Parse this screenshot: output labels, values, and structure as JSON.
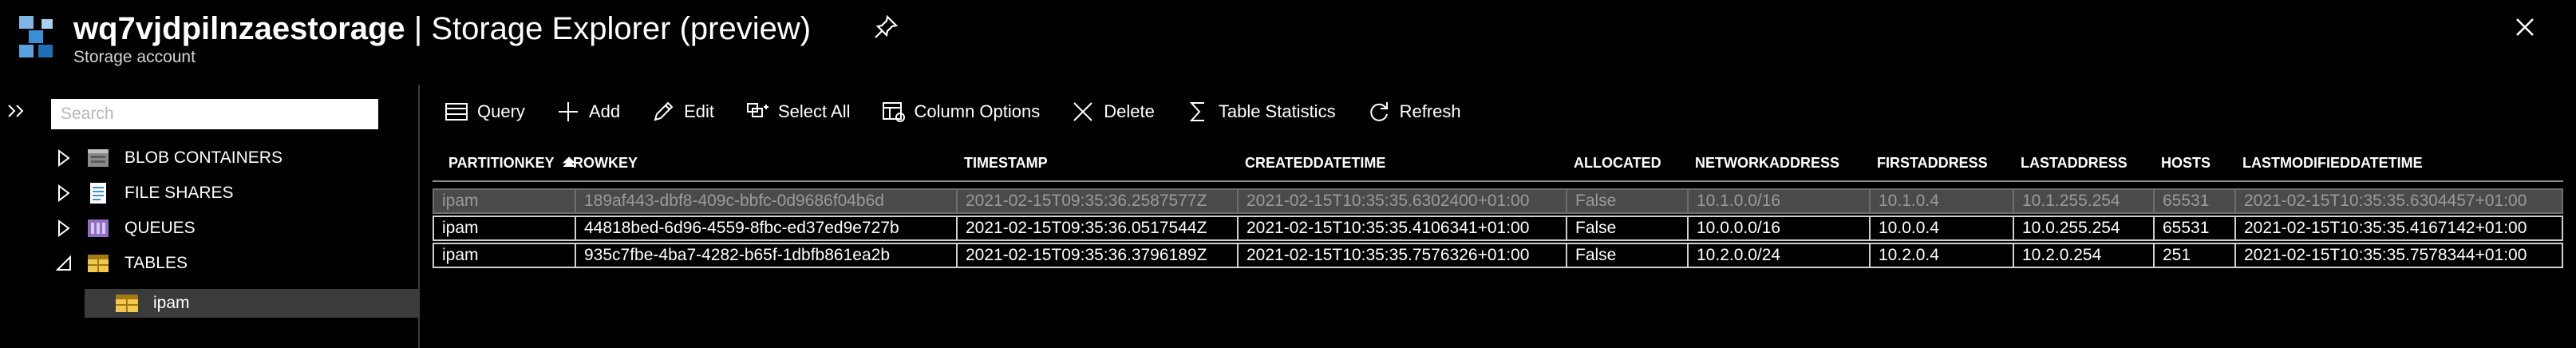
{
  "header": {
    "resource_name": "wq7vjdpilnzaestorage",
    "separator": "|",
    "blade_title": "Storage Explorer (preview)",
    "subtitle": "Storage account",
    "pin_icon": "pin-icon",
    "close_icon": "close-icon"
  },
  "sidebar": {
    "search_placeholder": "Search",
    "items": [
      {
        "label": "BLOB CONTAINERS",
        "icon": "blob-containers-icon",
        "expanded": false
      },
      {
        "label": "FILE SHARES",
        "icon": "file-shares-icon",
        "expanded": false
      },
      {
        "label": "QUEUES",
        "icon": "queues-icon",
        "expanded": false
      },
      {
        "label": "TABLES",
        "icon": "tables-icon",
        "expanded": true
      }
    ],
    "children": [
      {
        "label": "ipam",
        "icon": "table-icon",
        "selected": true
      }
    ]
  },
  "toolbar": {
    "query": "Query",
    "add": "Add",
    "edit": "Edit",
    "select_all": "Select All",
    "column_options": "Column Options",
    "delete": "Delete",
    "table_statistics": "Table Statistics",
    "refresh": "Refresh"
  },
  "table": {
    "columns": [
      "PARTITIONKEY",
      "ROWKEY",
      "TIMESTAMP",
      "CREATEDDATETIME",
      "ALLOCATED",
      "NETWORKADDRESS",
      "FIRSTADDRESS",
      "LASTADDRESS",
      "HOSTS",
      "LASTMODIFIEDDATETIME"
    ],
    "sorted_column": "PARTITIONKEY",
    "rows": [
      [
        "ipam",
        "189af443-dbf8-409c-bbfc-0d9686f04b6d",
        "2021-02-15T09:35:36.2587577Z",
        "2021-02-15T10:35:35.6302400+01:00",
        "False",
        "10.1.0.0/16",
        "10.1.0.4",
        "10.1.255.254",
        "65531",
        "2021-02-15T10:35:35.6304457+01:00"
      ],
      [
        "ipam",
        "44818bed-6d96-4559-8fbc-ed37ed9e727b",
        "2021-02-15T09:35:36.0517544Z",
        "2021-02-15T10:35:35.4106341+01:00",
        "False",
        "10.0.0.0/16",
        "10.0.0.4",
        "10.0.255.254",
        "65531",
        "2021-02-15T10:35:35.4167142+01:00"
      ],
      [
        "ipam",
        "935c7fbe-4ba7-4282-b65f-1dbfb861ea2b",
        "2021-02-15T09:35:36.3796189Z",
        "2021-02-15T10:35:35.7576326+01:00",
        "False",
        "10.2.0.0/24",
        "10.2.0.4",
        "10.2.0.254",
        "251",
        "2021-02-15T10:35:35.7578344+01:00"
      ]
    ],
    "selected_row": 0
  },
  "colors": {
    "background": "#000000",
    "selected_row": "#4a4a4a",
    "selected_tree_item": "#3b3b3b",
    "row_border": "#d0d0d0",
    "logo_blue": "#3b8fd6"
  }
}
